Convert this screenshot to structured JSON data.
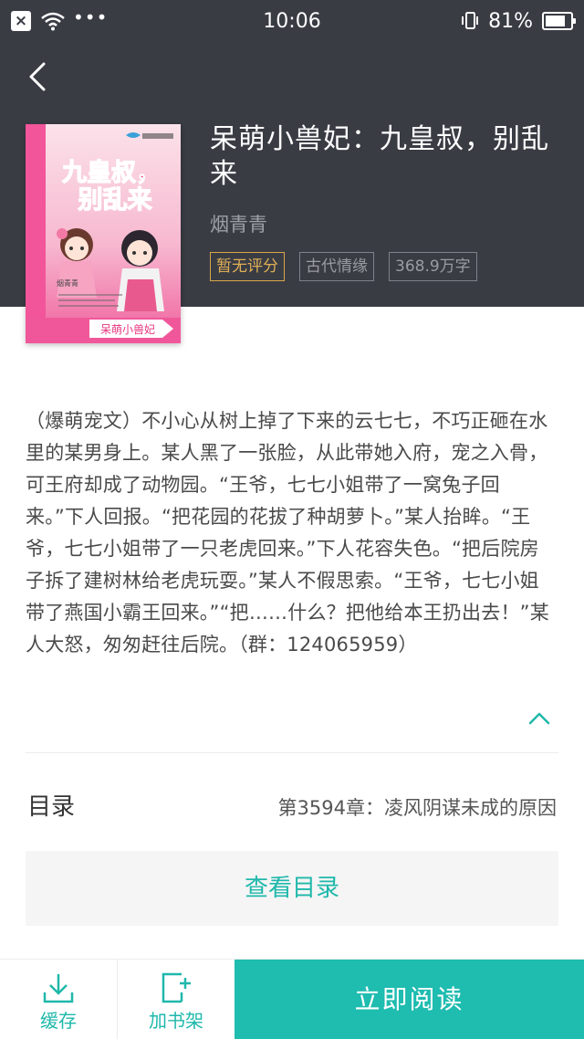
{
  "status_bar": {
    "time": "10:06",
    "battery": "81%",
    "icons": [
      "close-notification-icon",
      "wifi-icon",
      "more-dots-icon",
      "vibrate-icon",
      "battery-icon"
    ]
  },
  "book": {
    "title": "呆萌小兽妃：九皇叔，别乱来",
    "author": "烟青青",
    "tags": [
      "暂无评分",
      "古代情缘",
      "368.9万字"
    ],
    "cover_text": {
      "title_art": "九皇叔，别乱来",
      "subtitle": "呆萌小兽妃",
      "author_sig": "烟青青"
    },
    "intro": "（爆萌宠文）不小心从树上掉了下来的云七七，不巧正砸在水里的某男身上。某人黑了一张脸，从此带她入府，宠之入骨，可王府却成了动物园。“王爷，七七小姐带了一窝兔子回来。”下人回报。“把花园的花拔了种胡萝卜。”某人抬眸。“王爷，七七小姐带了一只老虎回来。”下人花容失色。“把后院房子拆了建树林给老虎玩耍。”某人不假思索。“王爷，七七小姐带了燕国小霸王回来。”“把……什么？把他给本王扔出去！”某人大怒，匆匆赶往后院。（群：124065959）"
  },
  "toc": {
    "label": "目录",
    "latest_chapter": "第3594章：凌风阴谋未成的原因",
    "view_button": "查看目录"
  },
  "bottom_bar": {
    "cache_label": "缓存",
    "shelf_label": "加书架",
    "read_label": "立即阅读"
  },
  "colors": {
    "header_bg": "#3a3c44",
    "accent": "#1fbcb0",
    "score_tag": "#e0b056"
  }
}
